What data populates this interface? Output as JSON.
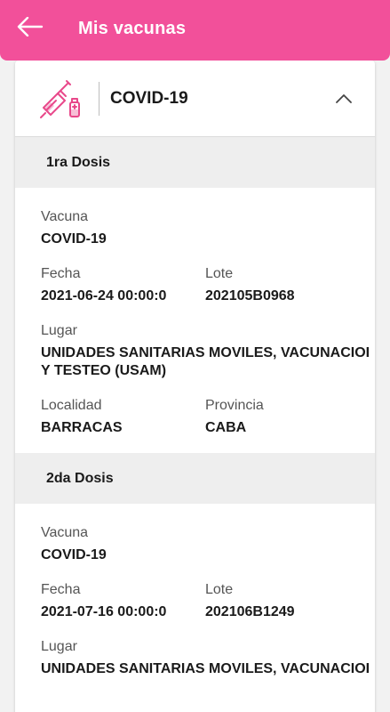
{
  "appbar": {
    "title": "Mis vacunas",
    "back_icon": "arrow-left-icon",
    "color": "#f2509a"
  },
  "card": {
    "title": "COVID-19",
    "icon": "syringe-icon",
    "toggle_icon": "chevron-up-icon"
  },
  "doses": [
    {
      "header": "1ra Dosis",
      "vacuna_label": "Vacuna",
      "vacuna": "COVID-19",
      "fecha_label": "Fecha",
      "fecha": "2021-06-24 00:00:0",
      "lote_label": "Lote",
      "lote": "202105B0968",
      "lugar_label": "Lugar",
      "lugar": "UNIDADES SANITARIAS MOVILES, VACUNACIOI Y TESTEO  (USAM)",
      "localidad_label": "Localidad",
      "localidad": "BARRACAS",
      "provincia_label": "Provincia",
      "provincia": "CABA"
    },
    {
      "header": "2da Dosis",
      "vacuna_label": "Vacuna",
      "vacuna": "COVID-19",
      "fecha_label": "Fecha",
      "fecha": "2021-07-16 00:00:0",
      "lote_label": "Lote",
      "lote": "202106B1249",
      "lugar_label": "Lugar",
      "lugar": "UNIDADES SANITARIAS MOVILES, VACUNACIOI"
    }
  ]
}
